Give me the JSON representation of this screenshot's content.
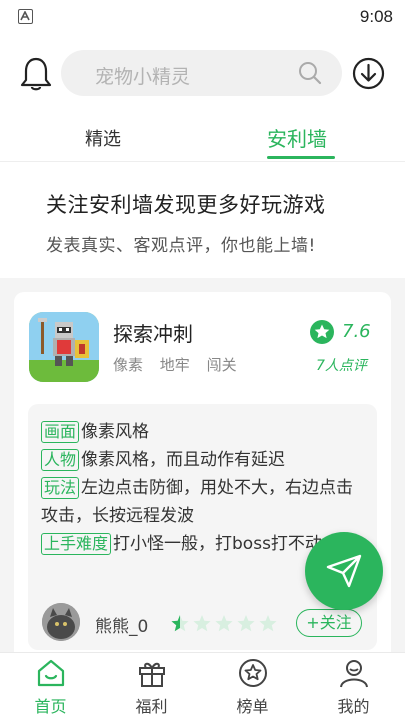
{
  "status_bar": {
    "time": "9:08",
    "app_icon": "a-letter-icon"
  },
  "header": {
    "bell_icon": "bell-icon",
    "search_placeholder": "宠物小精灵",
    "search_icon": "search-icon",
    "download_icon": "download-icon"
  },
  "tabs": [
    {
      "label": "精选",
      "active": false
    },
    {
      "label": "安利墙",
      "active": true
    }
  ],
  "intro": {
    "title": "关注安利墙发现更多好玩游戏",
    "subtitle": "发表真实、客观点评，你也能上墙!"
  },
  "card": {
    "game_name": "探索冲刺",
    "tags": [
      "像素",
      "地牢",
      "闯关"
    ],
    "rating_score": "7.6",
    "rating_count": "7人点评",
    "review": [
      {
        "tag": "画面",
        "text": "像素风格"
      },
      {
        "tag": "人物",
        "text": "像素风格，而且动作有延迟"
      },
      {
        "tag": "玩法",
        "text": "左边点击防御，用处不大，右边点击攻击，长按远程发波"
      },
      {
        "tag": "上手难度",
        "text": "打小怪一般，打boss打不动..."
      }
    ],
    "reviewer": {
      "name": "熊熊_0",
      "stars": 0.5,
      "stars_max": 5
    },
    "follow_label": "+关注"
  },
  "fab_icon": "send-icon",
  "bottom_nav": [
    {
      "label": "首页",
      "icon": "home-icon",
      "active": true
    },
    {
      "label": "福利",
      "icon": "gift-icon",
      "active": false
    },
    {
      "label": "榜单",
      "icon": "ranking-icon",
      "active": false
    },
    {
      "label": "我的",
      "icon": "profile-icon",
      "active": false
    }
  ],
  "colors": {
    "accent": "#2bb55d",
    "star_inactive": "#d8efe0"
  }
}
